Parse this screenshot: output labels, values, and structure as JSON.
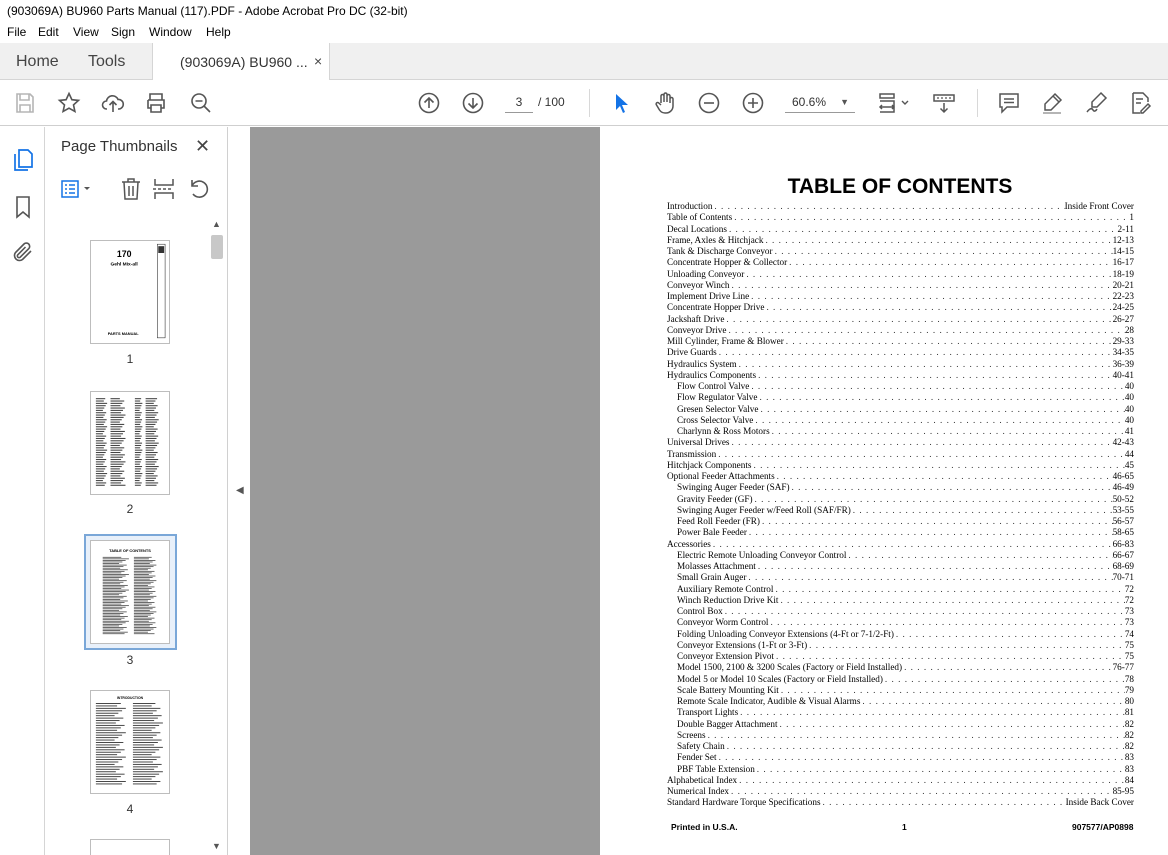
{
  "window": {
    "title": "(903069A) BU960 Parts Manual (117).PDF - Adobe Acrobat Pro DC (32-bit)"
  },
  "menu": [
    "File",
    "Edit",
    "View",
    "Sign",
    "Window",
    "Help"
  ],
  "tabs": {
    "home": "Home",
    "tools": "Tools",
    "document": "(903069A) BU960 ...",
    "close": "×"
  },
  "toolbar": {
    "page_current": "3",
    "page_total": "/ 100",
    "zoom": "60.6%"
  },
  "thumbnails_panel": {
    "title": "Page Thumbnails",
    "close": "✕",
    "pages": [
      {
        "number": "1",
        "model": "170",
        "brand": "Gehl Mix-all",
        "footer": "PARTS MANUAL"
      },
      {
        "number": "2"
      },
      {
        "number": "3",
        "selected": true,
        "header": "TABLE OF CONTENTS"
      },
      {
        "number": "4",
        "header": "INTRODUCTION"
      }
    ]
  },
  "document": {
    "title": "TABLE OF CONTENTS",
    "entries": [
      {
        "title": "Introduction",
        "page": "Inside Front Cover",
        "indent": false
      },
      {
        "title": "Table of Contents",
        "page": "1",
        "indent": false
      },
      {
        "title": "Decal Locations",
        "page": "2-11",
        "indent": false
      },
      {
        "title": "Frame, Axles & Hitchjack",
        "page": "12-13",
        "indent": false
      },
      {
        "title": "Tank & Discharge Conveyor",
        "page": "14-15",
        "indent": false
      },
      {
        "title": "Concentrate Hopper & Collector",
        "page": "16-17",
        "indent": false
      },
      {
        "title": "Unloading Conveyor",
        "page": "18-19",
        "indent": false
      },
      {
        "title": "Conveyor Winch",
        "page": "20-21",
        "indent": false
      },
      {
        "title": "Implement Drive Line",
        "page": "22-23",
        "indent": false
      },
      {
        "title": "Concentrate Hopper Drive",
        "page": "24-25",
        "indent": false
      },
      {
        "title": "Jackshaft Drive",
        "page": "26-27",
        "indent": false
      },
      {
        "title": "Conveyor Drive",
        "page": "28",
        "indent": false
      },
      {
        "title": "Mill Cylinder, Frame & Blower",
        "page": "29-33",
        "indent": false
      },
      {
        "title": "Drive Guards",
        "page": "34-35",
        "indent": false
      },
      {
        "title": "Hydraulics System",
        "page": "36-39",
        "indent": false
      },
      {
        "title": "Hydraulics Components",
        "page": "40-41",
        "indent": false
      },
      {
        "title": "Flow Control Valve",
        "page": "40",
        "indent": true
      },
      {
        "title": "Flow Regulator Valve",
        "page": "40",
        "indent": true
      },
      {
        "title": "Gresen Selector Valve",
        "page": "40",
        "indent": true
      },
      {
        "title": "Cross Selector Valve",
        "page": "40",
        "indent": true
      },
      {
        "title": "Charlynn & Ross Motors",
        "page": "41",
        "indent": true
      },
      {
        "title": "Universal Drives",
        "page": "42-43",
        "indent": false
      },
      {
        "title": "Transmission",
        "page": "44",
        "indent": false
      },
      {
        "title": "Hitchjack Components",
        "page": "45",
        "indent": false
      },
      {
        "title": "Optional Feeder Attachments",
        "page": "46-65",
        "indent": false
      },
      {
        "title": "Swinging Auger Feeder (SAF)",
        "page": "46-49",
        "indent": true
      },
      {
        "title": "Gravity Feeder (GF)",
        "page": "50-52",
        "indent": true
      },
      {
        "title": "Swinging Auger Feeder w/Feed Roll (SAF/FR)",
        "page": "53-55",
        "indent": true
      },
      {
        "title": "Feed Roll Feeder (FR)",
        "page": "56-57",
        "indent": true
      },
      {
        "title": "Power Bale Feeder",
        "page": "58-65",
        "indent": true
      },
      {
        "title": "Accessories",
        "page": "66-83",
        "indent": false
      },
      {
        "title": "Electric Remote Unloading Conveyor Control",
        "page": "66-67",
        "indent": true
      },
      {
        "title": "Molasses Attachment",
        "page": "68-69",
        "indent": true
      },
      {
        "title": "Small Grain Auger",
        "page": "70-71",
        "indent": true
      },
      {
        "title": "Auxiliary Remote Control",
        "page": "72",
        "indent": true
      },
      {
        "title": "Winch Reduction Drive Kit",
        "page": "72",
        "indent": true
      },
      {
        "title": "Control Box",
        "page": "73",
        "indent": true
      },
      {
        "title": "Conveyor Worm Control",
        "page": "73",
        "indent": true
      },
      {
        "title": "Folding Unloading Conveyor Extensions (4-Ft or 7-1/2-Ft)",
        "page": "74",
        "indent": true
      },
      {
        "title": "Conveyor Extensions (1-Ft or 3-Ft)",
        "page": "75",
        "indent": true
      },
      {
        "title": "Conveyor Extension Pivot",
        "page": "75",
        "indent": true
      },
      {
        "title": "Model 1500, 2100 & 3200 Scales (Factory or Field Installed)",
        "page": "76-77",
        "indent": true
      },
      {
        "title": "Model 5 or Model 10 Scales (Factory or Field Installed)",
        "page": "78",
        "indent": true
      },
      {
        "title": "Scale Battery Mounting Kit",
        "page": "79",
        "indent": true
      },
      {
        "title": "Remote Scale Indicator, Audible & Visual Alarms",
        "page": "80",
        "indent": true
      },
      {
        "title": "Transport Lights",
        "page": "81",
        "indent": true
      },
      {
        "title": "Double Bagger Attachment",
        "page": "82",
        "indent": true
      },
      {
        "title": "Screens",
        "page": "82",
        "indent": true
      },
      {
        "title": "Safety Chain",
        "page": "82",
        "indent": true
      },
      {
        "title": "Fender Set",
        "page": "83",
        "indent": true
      },
      {
        "title": "PBF Table Extension",
        "page": "83",
        "indent": true
      },
      {
        "title": "Alphabetical Index",
        "page": "84",
        "indent": false
      },
      {
        "title": "Numerical Index",
        "page": "85-95",
        "indent": false
      },
      {
        "title": "Standard Hardware Torque Specifications",
        "page": "Inside Back Cover",
        "indent": false
      }
    ],
    "footer": {
      "left": "Printed in U.S.A.",
      "center": "1",
      "right": "907577/AP0898"
    }
  }
}
